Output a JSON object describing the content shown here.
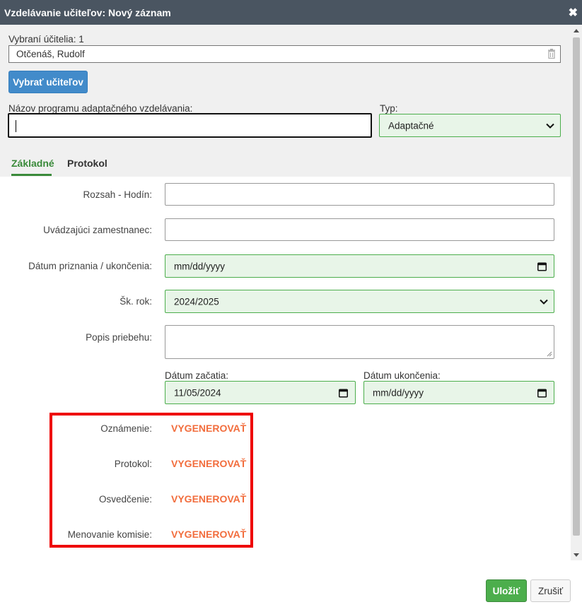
{
  "dialog": {
    "title": "Vzdelávanie učiteľov: Nový záznam",
    "close_symbol": "✖"
  },
  "teachers": {
    "label": "Vybraní účitelia: 1",
    "selected": "Otčenáš, Rudolf",
    "select_button": "Vybrať učiteľov"
  },
  "program": {
    "label": "Názov programu adaptačného vzdelávania:",
    "value": ""
  },
  "type": {
    "label": "Typ:",
    "value": "Adaptačné"
  },
  "tabs": [
    {
      "label": "Základné",
      "active": true
    },
    {
      "label": "Protokol",
      "active": false
    }
  ],
  "form": {
    "hours_label": "Rozsah - Hodín:",
    "hours_value": "",
    "employee_label": "Uvádzajúci zamestnanec:",
    "employee_value": "",
    "award_date_label": "Dátum priznania / ukončenia:",
    "award_date_value": "mm/dd/yyyy",
    "school_year_label": "Šk. rok:",
    "school_year_value": "2024/2025",
    "description_label": "Popis priebehu:",
    "description_value": "",
    "start_date_label": "Dátum začatia:",
    "start_date_value": "11/05/2024",
    "end_date_label": "Dátum ukončenia:",
    "end_date_value": "mm/dd/yyyy"
  },
  "documents": [
    {
      "label": "Oznámenie:",
      "action": "VYGENEROVAŤ"
    },
    {
      "label": "Protokol:",
      "action": "VYGENEROVAŤ"
    },
    {
      "label": "Osvedčenie:",
      "action": "VYGENEROVAŤ"
    },
    {
      "label": "Menovanie komisie:",
      "action": "VYGENEROVAŤ"
    }
  ],
  "footer": {
    "save_label": "Uložiť",
    "cancel_label": "Zrušiť"
  },
  "colors": {
    "titlebar": "#4a5561",
    "primary_button": "#428bca",
    "save_button": "#4cae4c",
    "active_tab": "#3a8a3a",
    "generate_link": "#f26d3d",
    "highlight_box": "#e00000",
    "field_bg": "#e8f5e8"
  },
  "icons": {
    "close": "close-icon",
    "trash": "trash-icon",
    "select_chevron": "chevron-down-icon",
    "calendar": "calendar-icon"
  }
}
